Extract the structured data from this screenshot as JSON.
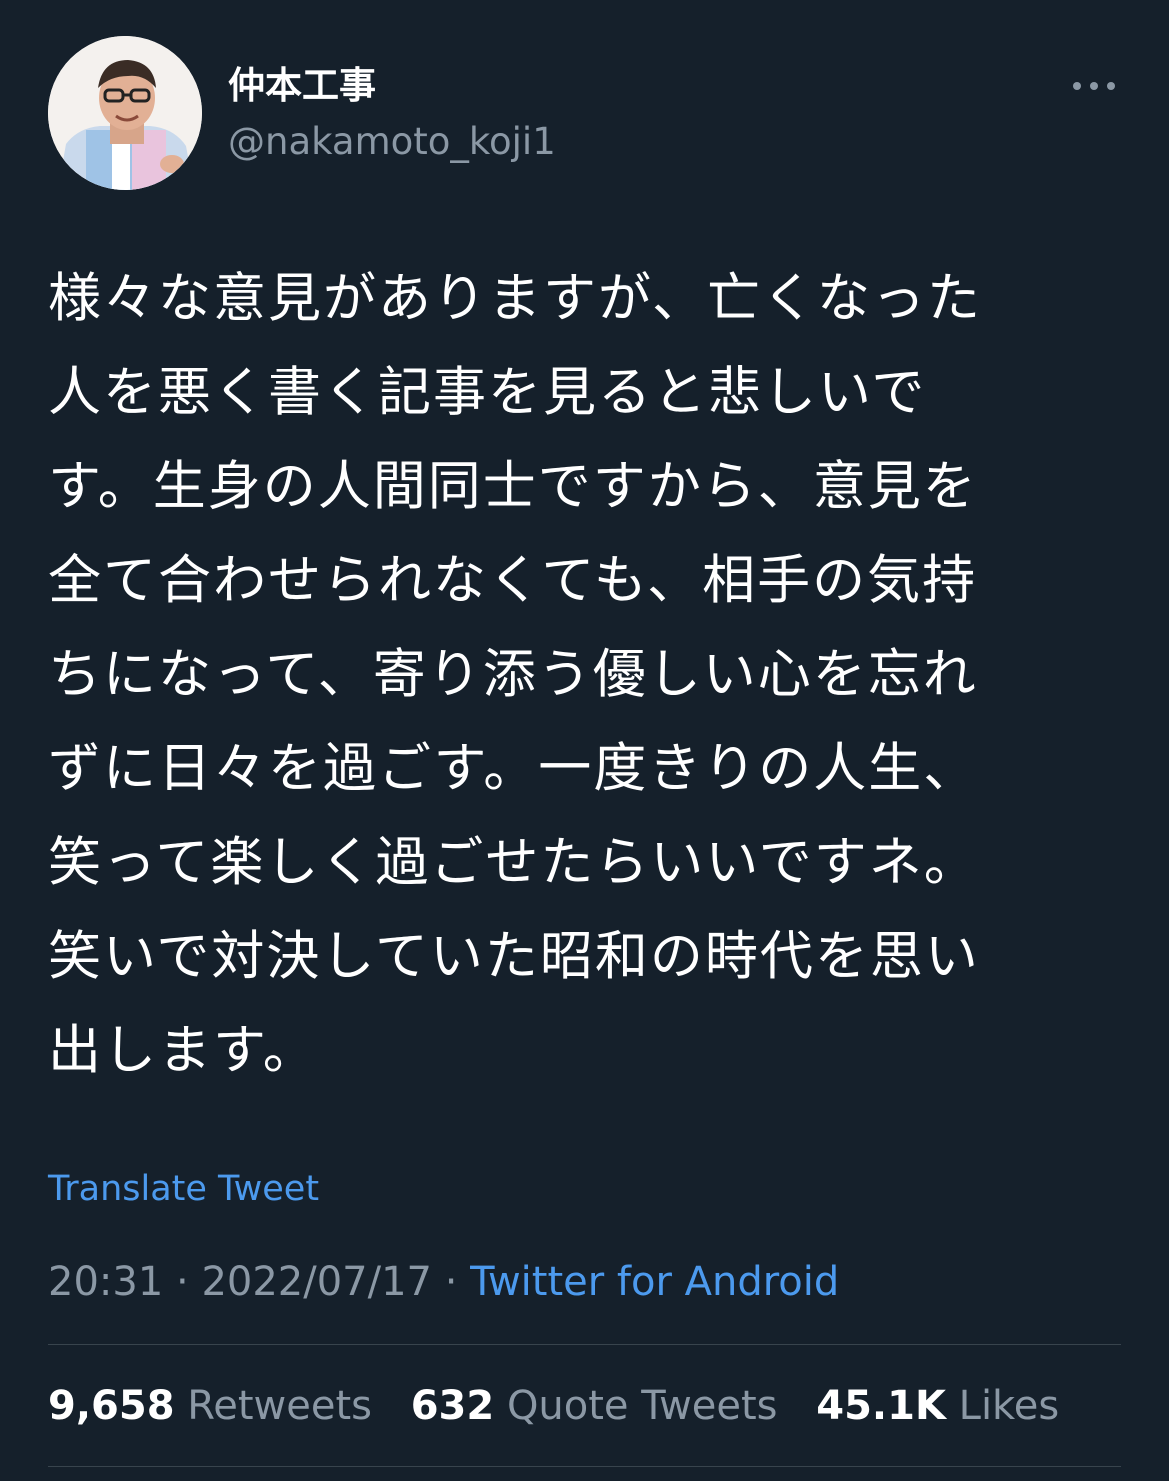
{
  "author": {
    "display_name": "仲本工事",
    "handle": "@nakamoto_koji1",
    "avatar_icon": "avatar-photo"
  },
  "more_icon": "more-horizontal-icon",
  "tweet": {
    "lines": [
      "様々な意見がありますが、亡くなった",
      "人を悪く書く記事を見ると悲しいで",
      "す。生身の人間同士ですから、意見を",
      "全て合わせられなくても、相手の気持",
      "ちになって、寄り添う優しい心を忘れ",
      "ずに日々を過ごす。一度きりの人生、",
      "笑って楽しく過ごせたらいいですネ。",
      "笑いで対決していた昭和の時代を思い",
      "出します。"
    ]
  },
  "translate_label": "Translate Tweet",
  "meta": {
    "time": "20:31",
    "separator": "·",
    "date": "2022/07/17",
    "source": "Twitter for Android"
  },
  "stats": {
    "retweets_count": "9,658",
    "retweets_label": "Retweets",
    "quotes_count": "632",
    "quotes_label": "Quote Tweets",
    "likes_count": "45.1K",
    "likes_label": "Likes"
  },
  "colors": {
    "background": "#15202b",
    "text": "#ffffff",
    "secondary": "#8b98a5",
    "link": "#4c9aee",
    "divider": "#38444d"
  }
}
